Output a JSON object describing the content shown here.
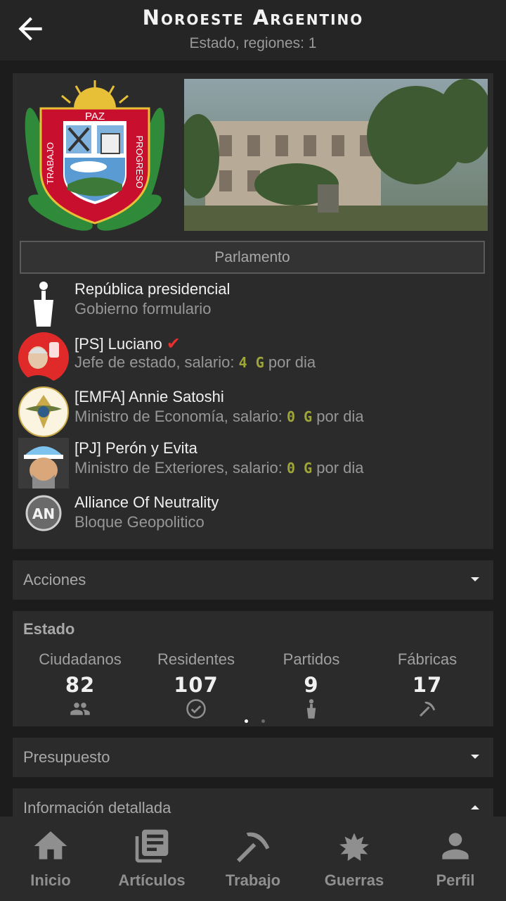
{
  "header": {
    "title": "Noroeste Argentino",
    "subtitle": "Estado, regiones: 1",
    "back_icon": "arrow-left-icon"
  },
  "state": {
    "coat_of_arms": {
      "motto_top": "PAZ",
      "motto_left": "TRABAJO",
      "motto_right": "PROGRESO"
    },
    "parliament_button": "Parlamento",
    "government": {
      "title": "República presidencial",
      "subtitle": "Gobierno formulario"
    },
    "officials": [
      {
        "title": "[PS] Luciano",
        "role": "Jefe de estado, salario:",
        "salary": "4 G",
        "per": "por dia",
        "verified": true
      },
      {
        "title": "[EMFA] Annie Satoshi",
        "role": "Ministro de Economía, salario:",
        "salary": "0 G",
        "per": "por dia"
      },
      {
        "title": "[PJ] Perón y Evita",
        "role": "Ministro de Exteriores, salario:",
        "salary": "0 G",
        "per": "por dia"
      }
    ],
    "bloc": {
      "title": "Alliance Of Neutrality",
      "subtitle": "Bloque Geopolitico",
      "logo_text": "AN"
    }
  },
  "sections": {
    "acciones": "Acciones",
    "presupuesto": "Presupuesto",
    "informacion": "Información detallada"
  },
  "estado": {
    "title": "Estado",
    "stats": [
      {
        "label": "Ciudadanos",
        "value": "82",
        "icon": "people-icon"
      },
      {
        "label": "Residentes",
        "value": "107",
        "icon": "check-circle-icon"
      },
      {
        "label": "Partidos",
        "value": "9",
        "icon": "person-podium-icon"
      },
      {
        "label": "Fábricas",
        "value": "17",
        "icon": "pickaxe-icon"
      }
    ],
    "page_count": 2,
    "active_page": 1
  },
  "nav": [
    {
      "label": "Inicio",
      "icon": "home-icon"
    },
    {
      "label": "Artículos",
      "icon": "articles-icon"
    },
    {
      "label": "Trabajo",
      "icon": "pickaxe-icon"
    },
    {
      "label": "Guerras",
      "icon": "explosion-icon"
    },
    {
      "label": "Perfil",
      "icon": "person-icon"
    }
  ],
  "colors": {
    "gold": "#9ea63a",
    "check": "#e53030",
    "background": "#1c1c1c",
    "card": "#2b2b2b"
  }
}
